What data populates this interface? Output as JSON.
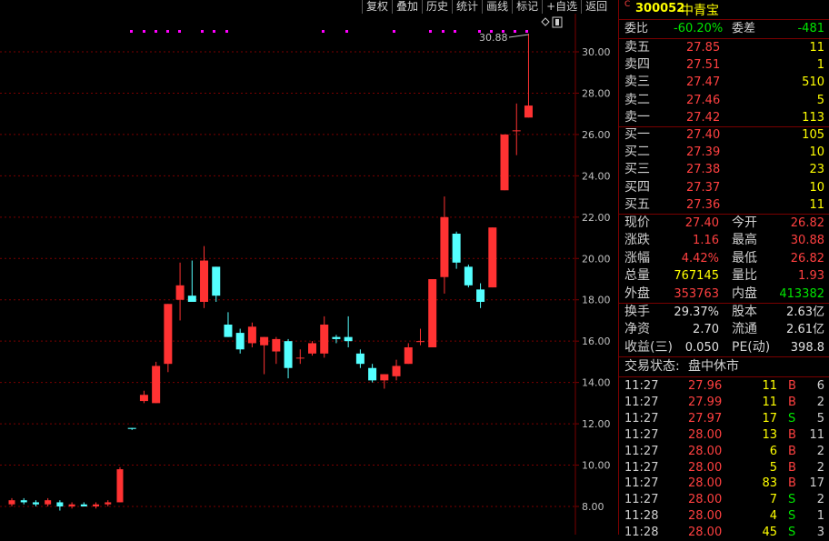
{
  "toolbar": [
    "复权",
    "叠加",
    "历史",
    "统计",
    "画线",
    "标记",
    "+自选",
    "返回"
  ],
  "chart": {
    "price_axis": [
      "30.00",
      "28.00",
      "26.00",
      "24.00",
      "22.00",
      "20.00",
      "18.00",
      "16.00",
      "14.00",
      "12.00",
      "10.00",
      "8.00"
    ],
    "max_label": "30.88",
    "colors": {
      "up": "#ff3232",
      "down": "#54ffff",
      "grid": "#7a0000",
      "axis_text": "#c0c0c0",
      "marker": "#ff00ff"
    }
  },
  "chart_data": {
    "type": "candlestick",
    "ylim": [
      7,
      32
    ],
    "candles": [
      {
        "o": 8.1,
        "h": 8.4,
        "l": 8.0,
        "c": 8.3
      },
      {
        "o": 8.3,
        "h": 8.4,
        "l": 8.1,
        "c": 8.2
      },
      {
        "o": 8.2,
        "h": 8.3,
        "l": 8.0,
        "c": 8.1
      },
      {
        "o": 8.1,
        "h": 8.4,
        "l": 8.0,
        "c": 8.3
      },
      {
        "o": 8.2,
        "h": 8.3,
        "l": 7.8,
        "c": 8.0
      },
      {
        "o": 8.0,
        "h": 8.2,
        "l": 7.9,
        "c": 8.1
      },
      {
        "o": 8.1,
        "h": 8.2,
        "l": 8.0,
        "c": 8.0
      },
      {
        "o": 8.0,
        "h": 8.2,
        "l": 7.9,
        "c": 8.1
      },
      {
        "o": 8.1,
        "h": 8.3,
        "l": 8.0,
        "c": 8.2
      },
      {
        "o": 8.2,
        "h": 9.9,
        "l": 8.2,
        "c": 9.8
      },
      {
        "o": 11.8,
        "h": 11.8,
        "l": 11.7,
        "c": 11.75
      },
      {
        "o": 13.1,
        "h": 13.6,
        "l": 13.0,
        "c": 13.4
      },
      {
        "o": 13.0,
        "h": 15.0,
        "l": 13.0,
        "c": 14.8
      },
      {
        "o": 14.9,
        "h": 17.8,
        "l": 14.5,
        "c": 17.8
      },
      {
        "o": 18.0,
        "h": 19.8,
        "l": 17.0,
        "c": 18.7
      },
      {
        "o": 18.2,
        "h": 19.9,
        "l": 18.0,
        "c": 17.9
      },
      {
        "o": 17.9,
        "h": 20.6,
        "l": 17.6,
        "c": 19.9
      },
      {
        "o": 19.6,
        "h": 19.6,
        "l": 17.9,
        "c": 18.2
      },
      {
        "o": 16.8,
        "h": 17.4,
        "l": 16.2,
        "c": 16.2
      },
      {
        "o": 16.4,
        "h": 16.6,
        "l": 15.4,
        "c": 15.6
      },
      {
        "o": 15.9,
        "h": 16.9,
        "l": 15.7,
        "c": 16.7
      },
      {
        "o": 15.8,
        "h": 16.2,
        "l": 14.4,
        "c": 16.2
      },
      {
        "o": 15.5,
        "h": 16.2,
        "l": 14.9,
        "c": 16.1
      },
      {
        "o": 16.0,
        "h": 16.1,
        "l": 14.2,
        "c": 14.7
      },
      {
        "o": 15.2,
        "h": 15.6,
        "l": 14.9,
        "c": 15.2
      },
      {
        "o": 15.4,
        "h": 16.0,
        "l": 15.3,
        "c": 15.9
      },
      {
        "o": 15.4,
        "h": 17.2,
        "l": 15.2,
        "c": 16.8
      },
      {
        "o": 16.2,
        "h": 16.3,
        "l": 15.9,
        "c": 16.1
      },
      {
        "o": 16.2,
        "h": 17.2,
        "l": 15.7,
        "c": 16.0
      },
      {
        "o": 15.4,
        "h": 15.6,
        "l": 14.7,
        "c": 14.9
      },
      {
        "o": 14.7,
        "h": 14.9,
        "l": 14.0,
        "c": 14.1
      },
      {
        "o": 14.1,
        "h": 14.4,
        "l": 13.7,
        "c": 14.4
      },
      {
        "o": 14.3,
        "h": 15.1,
        "l": 14.1,
        "c": 14.8
      },
      {
        "o": 14.9,
        "h": 15.9,
        "l": 14.9,
        "c": 15.7
      },
      {
        "o": 16.0,
        "h": 16.6,
        "l": 15.8,
        "c": 16.0
      },
      {
        "o": 15.7,
        "h": 19.0,
        "l": 15.7,
        "c": 19.0
      },
      {
        "o": 19.1,
        "h": 23.0,
        "l": 18.3,
        "c": 22.0
      },
      {
        "o": 21.2,
        "h": 21.3,
        "l": 19.5,
        "c": 19.8
      },
      {
        "o": 19.6,
        "h": 19.7,
        "l": 18.6,
        "c": 18.7
      },
      {
        "o": 18.5,
        "h": 18.8,
        "l": 17.6,
        "c": 17.9
      },
      {
        "o": 18.6,
        "h": 21.5,
        "l": 18.6,
        "c": 21.5
      },
      {
        "o": 23.3,
        "h": 26.0,
        "l": 23.3,
        "c": 26.0
      },
      {
        "o": 26.2,
        "h": 27.5,
        "l": 25.0,
        "c": 26.2
      },
      {
        "o": 26.82,
        "h": 30.88,
        "l": 26.82,
        "c": 27.4
      }
    ]
  },
  "panel": {
    "code": "300052",
    "name": "中青宝",
    "weibi_label": "委比",
    "weibi": "-60.20%",
    "weicha_label": "委差",
    "weicha": "-481",
    "asks": [
      {
        "label": "卖五",
        "price": "27.85",
        "vol": "11"
      },
      {
        "label": "卖四",
        "price": "27.51",
        "vol": "1"
      },
      {
        "label": "卖三",
        "price": "27.47",
        "vol": "510"
      },
      {
        "label": "卖二",
        "price": "27.46",
        "vol": "5"
      },
      {
        "label": "卖一",
        "price": "27.42",
        "vol": "113"
      }
    ],
    "bids": [
      {
        "label": "买一",
        "price": "27.40",
        "vol": "105"
      },
      {
        "label": "买二",
        "price": "27.39",
        "vol": "10"
      },
      {
        "label": "买三",
        "price": "27.38",
        "vol": "23"
      },
      {
        "label": "买四",
        "price": "27.37",
        "vol": "10"
      },
      {
        "label": "买五",
        "price": "27.36",
        "vol": "11"
      }
    ],
    "quote": [
      {
        "l1": "现价",
        "v1": "27.40",
        "c1": "red",
        "l2": "今开",
        "v2": "26.82",
        "c2": "red"
      },
      {
        "l1": "涨跌",
        "v1": "1.16",
        "c1": "red",
        "l2": "最高",
        "v2": "30.88",
        "c2": "red"
      },
      {
        "l1": "涨幅",
        "v1": "4.42%",
        "c1": "red",
        "l2": "最低",
        "v2": "26.82",
        "c2": "red"
      },
      {
        "l1": "总量",
        "v1": "767145",
        "c1": "yellow",
        "l2": "量比",
        "v2": "1.93",
        "c2": "red"
      },
      {
        "l1": "外盘",
        "v1": "353763",
        "c1": "red",
        "l2": "内盘",
        "v2": "413382",
        "c2": "green"
      }
    ],
    "fund": [
      {
        "l1": "换手",
        "v1": "29.37%",
        "l2": "股本",
        "v2": "2.63亿"
      },
      {
        "l1": "净资",
        "v1": "2.70",
        "l2": "流通",
        "v2": "2.61亿"
      },
      {
        "l1": "收益(三)",
        "v1": "0.050",
        "l2": "PE(动)",
        "v2": "398.8"
      }
    ],
    "status_label": "交易状态:",
    "status_value": "盘中休市",
    "ticks": [
      {
        "t": "11:27",
        "p": "27.96",
        "v": "11",
        "bs": "B",
        "n": "6"
      },
      {
        "t": "11:27",
        "p": "27.99",
        "v": "11",
        "bs": "B",
        "n": "2"
      },
      {
        "t": "11:27",
        "p": "27.97",
        "v": "17",
        "bs": "S",
        "n": "5"
      },
      {
        "t": "11:27",
        "p": "28.00",
        "v": "13",
        "bs": "B",
        "n": "11"
      },
      {
        "t": "11:27",
        "p": "28.00",
        "v": "6",
        "bs": "B",
        "n": "2"
      },
      {
        "t": "11:27",
        "p": "28.00",
        "v": "5",
        "bs": "B",
        "n": "2"
      },
      {
        "t": "11:27",
        "p": "28.00",
        "v": "83",
        "bs": "B",
        "n": "17"
      },
      {
        "t": "11:27",
        "p": "28.00",
        "v": "7",
        "bs": "S",
        "n": "2"
      },
      {
        "t": "11:28",
        "p": "28.00",
        "v": "4",
        "bs": "S",
        "n": "1"
      },
      {
        "t": "11:28",
        "p": "28.00",
        "v": "45",
        "bs": "S",
        "n": "3"
      }
    ]
  }
}
